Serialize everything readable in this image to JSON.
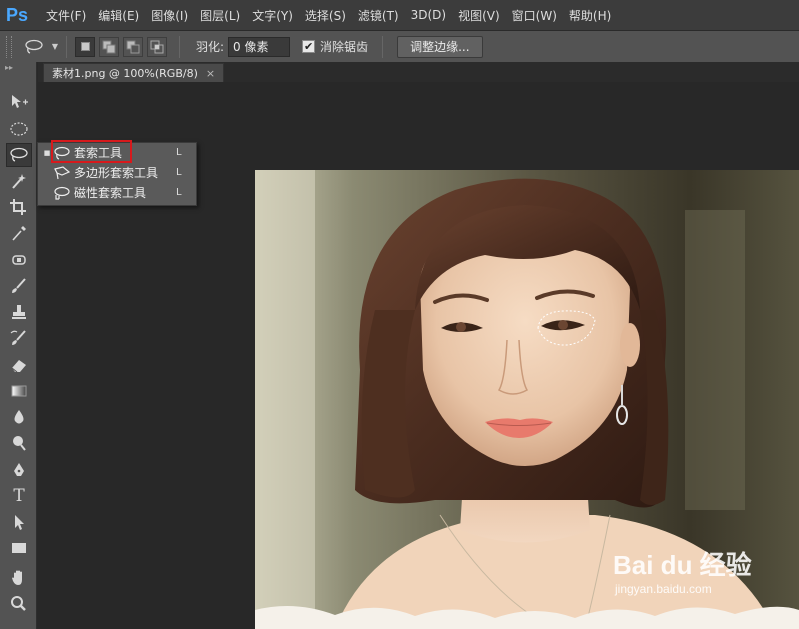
{
  "app": {
    "logo": "Ps"
  },
  "menu": [
    "文件(F)",
    "编辑(E)",
    "图像(I)",
    "图层(L)",
    "文字(Y)",
    "选择(S)",
    "滤镜(T)",
    "3D(D)",
    "视图(V)",
    "窗口(W)",
    "帮助(H)"
  ],
  "options_bar": {
    "feather_label": "羽化:",
    "feather_value": "0 像素",
    "antialias_label": "消除锯齿",
    "antialias_checked": true,
    "refine_edge_button": "调整边缘..."
  },
  "tab": {
    "title": "素材1.png @ 100%(RGB/8)",
    "close": "×"
  },
  "flyout": {
    "items": [
      {
        "label": "套索工具",
        "shortcut": "L",
        "selected": true,
        "icon": "lasso-icon"
      },
      {
        "label": "多边形套索工具",
        "shortcut": "L",
        "selected": false,
        "icon": "polygonal-lasso-icon"
      },
      {
        "label": "磁性套索工具",
        "shortcut": "L",
        "selected": false,
        "icon": "magnetic-lasso-icon"
      }
    ]
  },
  "watermark": {
    "brand": "Bai du 经验",
    "url": "jingyan.baidu.com"
  },
  "colors": {
    "highlight": "#d7191c",
    "ps_blue": "#4aa8ff",
    "panel": "#535353",
    "canvas_bg": "#282828"
  }
}
